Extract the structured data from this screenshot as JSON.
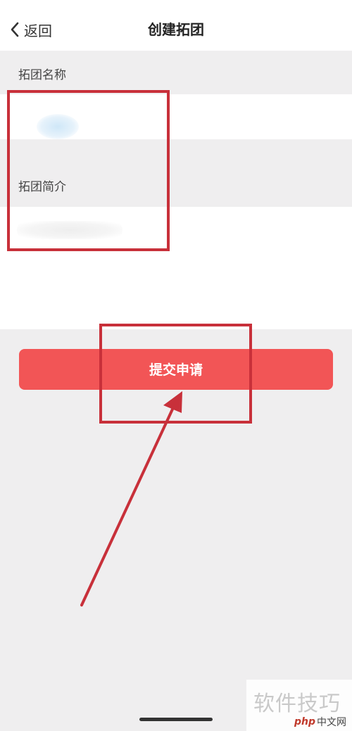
{
  "navbar": {
    "back_label": "返回",
    "title": "创建拓团"
  },
  "form": {
    "name_label": "拓团名称",
    "intro_label": "拓团简介"
  },
  "submit_label": "提交申请",
  "annotation_color": "#c8303a",
  "button_color": "#f25556",
  "watermark": {
    "text": "软件技巧",
    "logo": "php",
    "site": "中文网"
  },
  "icons": {
    "back": "chevron-left-icon"
  }
}
